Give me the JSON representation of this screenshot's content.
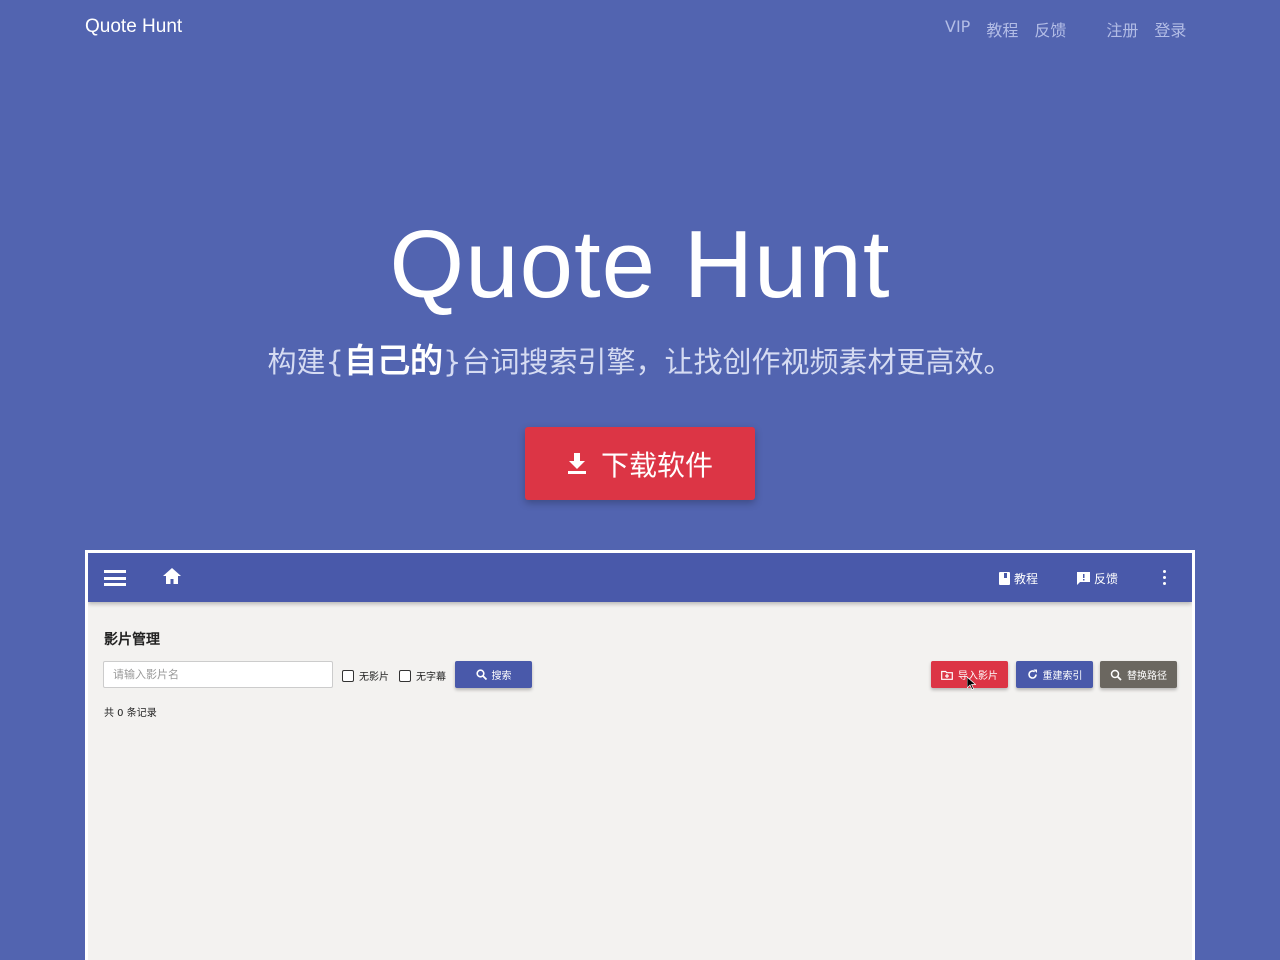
{
  "nav": {
    "brand": "Quote Hunt",
    "links": [
      "VIP",
      "教程",
      "反馈"
    ],
    "auth": [
      "注册",
      "登录"
    ]
  },
  "hero": {
    "title": "Quote Hunt",
    "subtitle_prefix": "构建{",
    "subtitle_bold": "自己的",
    "subtitle_suffix": "}台词搜索引擎，让找创作视频素材更高效。",
    "download_label": "下载软件",
    "download_color": "#dc3545"
  },
  "app": {
    "bar_color": "#4959aa",
    "tutorial_label": "教程",
    "feedback_label": "反馈",
    "page_title": "影片管理",
    "search_placeholder": "请输入影片名",
    "filter_no_movie": "无影片",
    "filter_no_subtitle": "无字幕",
    "search_label": "搜索",
    "import_label": "导入影片",
    "rebuild_label": "重建索引",
    "replace_label": "替换路径",
    "record_count": "共 0 条记录"
  }
}
